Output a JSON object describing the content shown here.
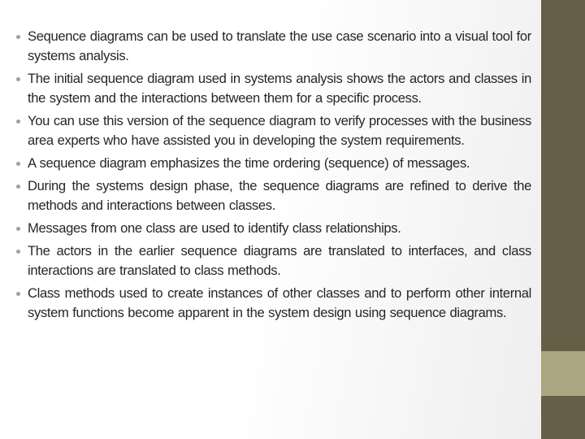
{
  "slide": {
    "bullets": [
      "Sequence diagrams can be used to translate the use case scenario into a visual tool for systems analysis.",
      "The initial sequence diagram used in systems analysis shows the actors and classes in the system and the interactions between them for a specific process.",
      "You can use this version of the sequence diagram to verify processes with the business area experts who have assisted you in developing the system requirements.",
      "A sequence diagram emphasizes the time ordering (sequence) of messages.",
      "During the systems design phase, the sequence diagrams are refined to derive the methods and interactions between classes.",
      "Messages from one class are used to identify class relationships.",
      "The actors in the earlier sequence diagrams are translated to interfaces, and class interactions are translated to class methods.",
      "Class methods used to create instances of other classes and to perform other internal system functions become apparent in the system design using sequence diagrams."
    ]
  },
  "theme": {
    "sidebar_color": "#665f48",
    "sidebar_accent": "#aaa67f",
    "text_color": "#262626"
  }
}
